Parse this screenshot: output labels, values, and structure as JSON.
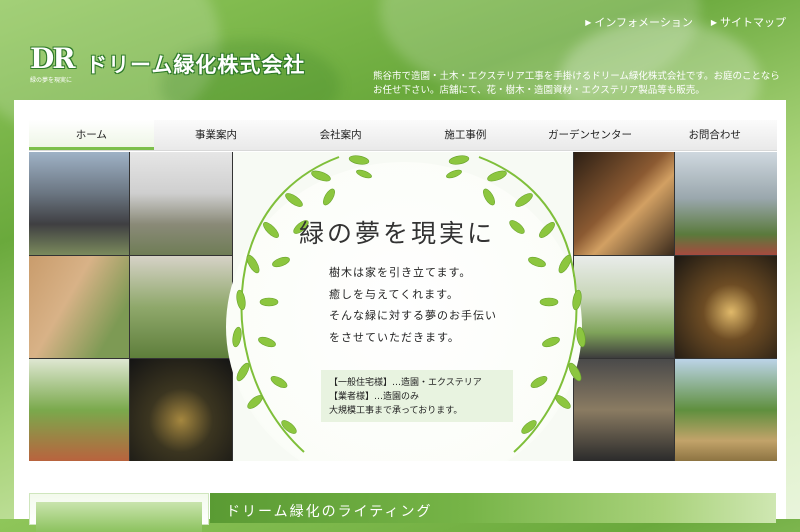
{
  "header": {
    "top_links": [
      "インフォメーション",
      "サイトマップ"
    ],
    "logo_mark": "DR",
    "logo_sub": "緑の夢を現実に",
    "company_name": "ドリーム緑化株式会社",
    "tagline": "熊谷市で造園・土木・エクステリア工事を手掛けるドリーム緑化株式会社です。お庭のことならお任せ下さい。店舗にて、花・樹木・造園資材・エクステリア製品等も販売。"
  },
  "nav": {
    "items": [
      "ホーム",
      "事業案内",
      "会社案内",
      "施工事例",
      "ガーデンセンター",
      "お問合わせ"
    ],
    "active": "ホーム"
  },
  "hero": {
    "title": "緑の夢を現実に",
    "lines": [
      "樹木は家を引き立てます。",
      "癒しを与えてくれます。",
      "そんな緑に対する夢のお手伝い",
      "をさせていただきます。"
    ],
    "box_lines": [
      "【一般住宅様】…造園・エクステリア",
      "【業者様】…造園のみ",
      "大規模工事まで承っております。"
    ]
  },
  "banner": {
    "title": "ドリーム緑化のライティング"
  },
  "colors": {
    "accent_green": "#7cbf4a",
    "logo_green": "#2f7a2a",
    "leaf_green": "#8cc63f"
  }
}
